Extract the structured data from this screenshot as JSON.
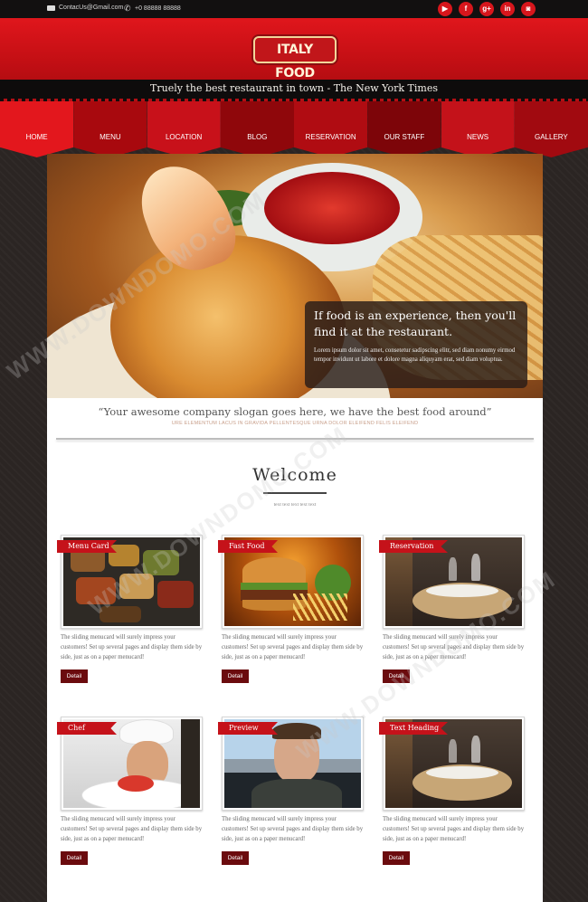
{
  "topbar": {
    "email": "ContacUs@Gmail.com",
    "phone": "+0 88888 88888",
    "socials": [
      {
        "name": "youtube",
        "glyph": "▶"
      },
      {
        "name": "facebook",
        "glyph": "f"
      },
      {
        "name": "google-plus",
        "glyph": "g+"
      },
      {
        "name": "linkedin",
        "glyph": "in"
      },
      {
        "name": "instagram",
        "glyph": "◙"
      }
    ]
  },
  "header": {
    "logo": "ITALY FOOD",
    "tagline": "Truely the best restaurant in town - The New York Times"
  },
  "nav": {
    "items": [
      "HOME",
      "MENU",
      "LOCATION",
      "BLOG",
      "RESERVATION",
      "OUR STAFF",
      "NEWS",
      "GALLERY"
    ]
  },
  "hero": {
    "heading": "If food is an experience, then you'll find it at the restaurant.",
    "body": "Lorem ipsum dolor sit amet, consetetur sadipscing elitr, sed diam nonumy eirmod tempor invidunt ut labore et dolore magna aliquyam erat, sed diam voluptua."
  },
  "slogan": {
    "main": "“Your awesome company slogan goes here, we have the best food around”",
    "sub": "URE ELEMENTUM LACUS IN GRAVIDA PELLENTESQUE URNA DOLOR ELEIFEND FELIS ELEIFEND"
  },
  "welcome": {
    "title": "Welcome",
    "sub": "text text text text text"
  },
  "cards": [
    {
      "title": "Menu Card",
      "text": "The sliding menucard will surely impress your customers! Set up several pages and display them side by side, just as on a paper menucard!",
      "button": "Detail"
    },
    {
      "title": "Fast Food",
      "text": "The sliding menucard will surely impress your customers! Set up several pages and display them side by side, just as on a paper menucard!",
      "button": "Detail"
    },
    {
      "title": "Reservation",
      "text": "The sliding menucard will surely impress your customers! Set up several pages and display them side by side, just as on a paper menucard!",
      "button": "Detail"
    },
    {
      "title": "Chef",
      "text": "The sliding menucard will surely impress your customers! Set up several pages and display them side by side, just as on a paper menucard!",
      "button": "Detail"
    },
    {
      "title": "Preview",
      "text": "The sliding menucard will surely impress your customers! Set up several pages and display them side by side, just as on a paper menucard!",
      "button": "Detail"
    },
    {
      "title": "Text Heading",
      "text": "The sliding menucard will surely impress your customers! Set up several pages and display them side by side, just as on a paper menucard!",
      "button": "Detail"
    }
  ],
  "watermark": "WWW.DOWNDOMO.COM",
  "colors": {
    "brand_red": "#e0161c",
    "dark_bg": "#2b2523",
    "button": "#6b0b0e"
  }
}
